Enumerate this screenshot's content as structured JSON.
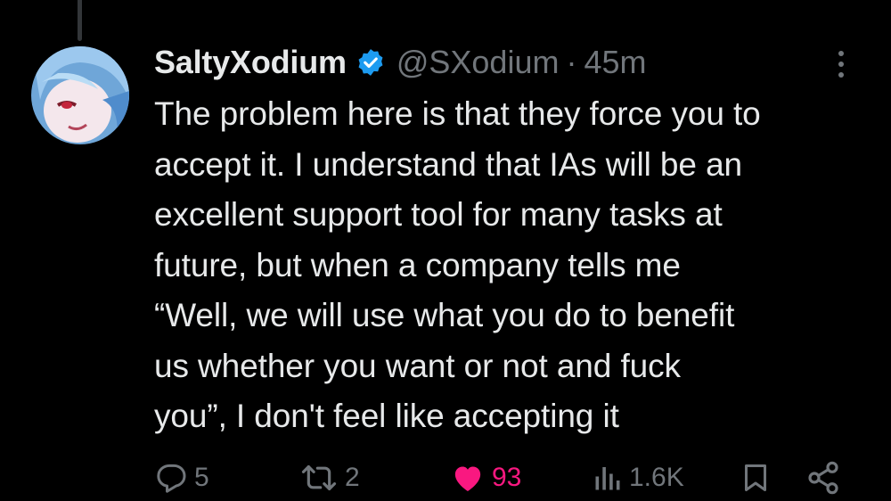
{
  "post": {
    "display_name": "SaltyXodium",
    "verified": true,
    "handle": "@SXodium",
    "separator": "·",
    "time": "45m",
    "body": "The problem here is that they force you to\naccept it. I understand that IAs will be an\nexcellent support tool for many tasks at\nfuture, but when a company tells me\n“Well, we will use what you do to benefit\nus whether you want or not and fuck\nyou”, I don't feel like accepting it"
  },
  "actions": {
    "replies": "5",
    "reposts": "2",
    "likes": "93",
    "views": "1.6K"
  },
  "icons": {
    "verified": "verified-badge-icon",
    "more": "more-vertical-icon",
    "reply": "reply-icon",
    "repost": "repost-icon",
    "like": "heart-icon",
    "views": "views-icon",
    "bookmark": "bookmark-icon",
    "share": "share-icon"
  },
  "colors": {
    "background": "#000000",
    "text": "#e7e9ea",
    "muted": "#71767b",
    "verified_blue": "#1d9bf0",
    "like_pink": "#f91880"
  }
}
